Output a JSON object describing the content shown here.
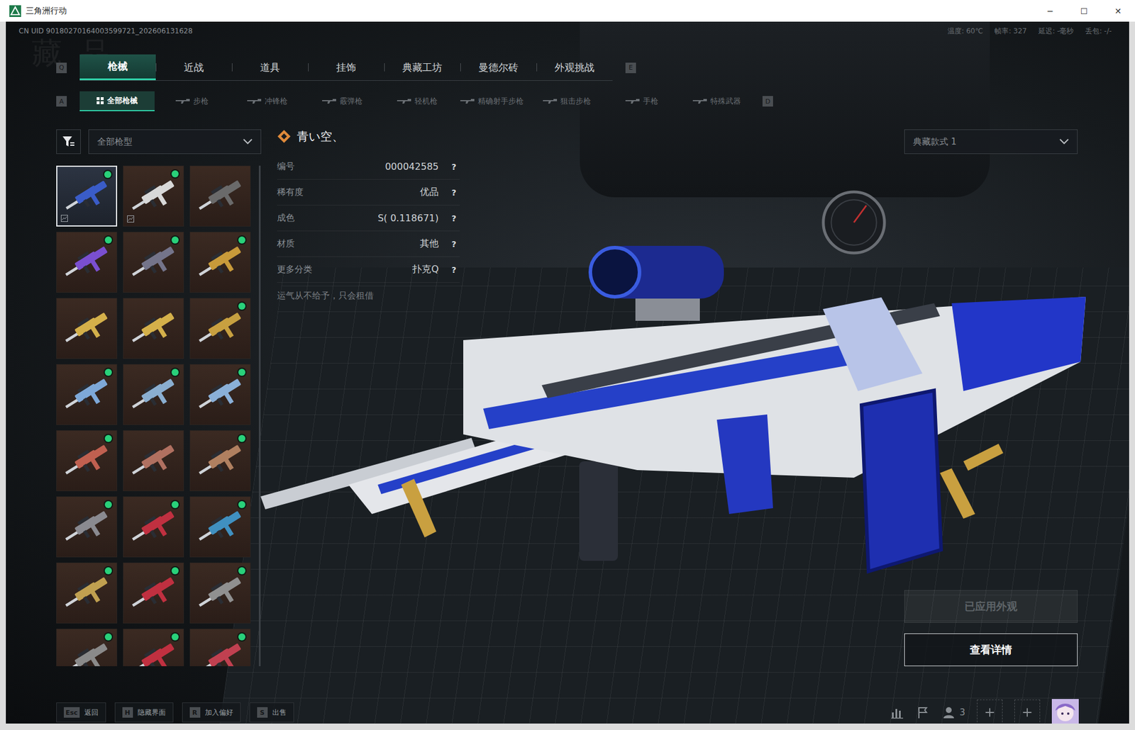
{
  "window": {
    "title": "三角洲行动",
    "controls": [
      "─",
      "☐",
      "✕"
    ]
  },
  "watermark": "藏品",
  "uid": "CN UID 90180270164003599721_202606131628",
  "stats": [
    "温度: 60℃",
    "帧率: 327",
    "延迟: -毫秒",
    "丢包: -/-"
  ],
  "main_tabs": {
    "prev_key": "Q",
    "next_key": "E",
    "items": [
      {
        "label": "枪械",
        "selected": true
      },
      {
        "label": "近战",
        "selected": false
      },
      {
        "label": "道具",
        "selected": false
      },
      {
        "label": "挂饰",
        "selected": false
      },
      {
        "label": "典藏工坊",
        "selected": false
      },
      {
        "label": "曼德尔砖",
        "selected": false
      },
      {
        "label": "外观挑战",
        "selected": false
      }
    ]
  },
  "sub_tabs": {
    "prev_key": "A",
    "next_key": "D",
    "items": [
      {
        "label": "全部枪械",
        "kind": "all",
        "selected": true
      },
      {
        "label": "步枪",
        "kind": "weapon",
        "selected": false
      },
      {
        "label": "冲锋枪",
        "kind": "weapon",
        "selected": false
      },
      {
        "label": "霰弹枪",
        "kind": "weapon",
        "selected": false
      },
      {
        "label": "轻机枪",
        "kind": "weapon",
        "selected": false
      },
      {
        "label": "精确射手步枪",
        "kind": "weapon",
        "selected": false
      },
      {
        "label": "狙击步枪",
        "kind": "weapon",
        "selected": false
      },
      {
        "label": "手枪",
        "kind": "weapon",
        "selected": false
      },
      {
        "label": "特殊武器",
        "kind": "weapon",
        "selected": false
      }
    ]
  },
  "filter": {
    "value": "全部枪型"
  },
  "skins": [
    {
      "selected": true,
      "marked": true,
      "styled": true,
      "color": "#3a5cc8"
    },
    {
      "selected": false,
      "marked": true,
      "styled": true,
      "color": "#d8d8d8"
    },
    {
      "selected": false,
      "marked": false,
      "styled": false,
      "color": "#6a6a6a"
    },
    {
      "selected": false,
      "marked": true,
      "styled": false,
      "color": "#7a4fd0"
    },
    {
      "selected": false,
      "marked": true,
      "styled": false,
      "color": "#74748a"
    },
    {
      "selected": false,
      "marked": true,
      "styled": false,
      "color": "#c89a3a"
    },
    {
      "selected": false,
      "marked": false,
      "styled": false,
      "color": "#d4b04a"
    },
    {
      "selected": false,
      "marked": false,
      "styled": false,
      "color": "#d4b04a"
    },
    {
      "selected": false,
      "marked": true,
      "styled": false,
      "color": "#c8a040"
    },
    {
      "selected": false,
      "marked": true,
      "styled": false,
      "color": "#7ea8d8"
    },
    {
      "selected": false,
      "marked": true,
      "styled": false,
      "color": "#8aaed0"
    },
    {
      "selected": false,
      "marked": true,
      "styled": false,
      "color": "#8ab0d8"
    },
    {
      "selected": false,
      "marked": true,
      "styled": false,
      "color": "#c06050"
    },
    {
      "selected": false,
      "marked": false,
      "styled": false,
      "color": "#b07060"
    },
    {
      "selected": false,
      "marked": true,
      "styled": false,
      "color": "#b08060"
    },
    {
      "selected": false,
      "marked": true,
      "styled": false,
      "color": "#8a8a90"
    },
    {
      "selected": false,
      "marked": true,
      "styled": false,
      "color": "#c03040"
    },
    {
      "selected": false,
      "marked": true,
      "styled": false,
      "color": "#4090c0"
    },
    {
      "selected": false,
      "marked": true,
      "styled": false,
      "color": "#c0a050"
    },
    {
      "selected": false,
      "marked": true,
      "styled": false,
      "color": "#c03040"
    },
    {
      "selected": false,
      "marked": true,
      "styled": false,
      "color": "#909090"
    },
    {
      "selected": false,
      "marked": true,
      "styled": false,
      "color": "#8a8a8a"
    },
    {
      "selected": false,
      "marked": true,
      "styled": false,
      "color": "#c03040"
    },
    {
      "selected": false,
      "marked": true,
      "styled": false,
      "color": "#c04050"
    }
  ],
  "detail": {
    "name": "青い空、",
    "fields": [
      {
        "label": "编号",
        "value": "000042585",
        "help": "?"
      },
      {
        "label": "稀有度",
        "value": "优品",
        "help": "?"
      },
      {
        "label": "成色",
        "value": "S( 0.118671)",
        "help": "?"
      },
      {
        "label": "材质",
        "value": "其他",
        "help": "?"
      },
      {
        "label": "更多分类",
        "value": "扑克Q",
        "help": "?"
      }
    ],
    "quote": "运气从不给予，只会租借"
  },
  "style_select": {
    "value": "典藏款式 1"
  },
  "buttons": [
    {
      "label": "已应用外观",
      "disabled": true
    },
    {
      "label": "查看详情",
      "disabled": false
    }
  ],
  "hints": [
    {
      "key": "Esc",
      "label": "返回"
    },
    {
      "key": "H",
      "label": "隐藏界面"
    },
    {
      "key": "R",
      "label": "加入偏好"
    },
    {
      "key": "S",
      "label": "出售"
    }
  ],
  "footer": {
    "friends_count": "3"
  }
}
